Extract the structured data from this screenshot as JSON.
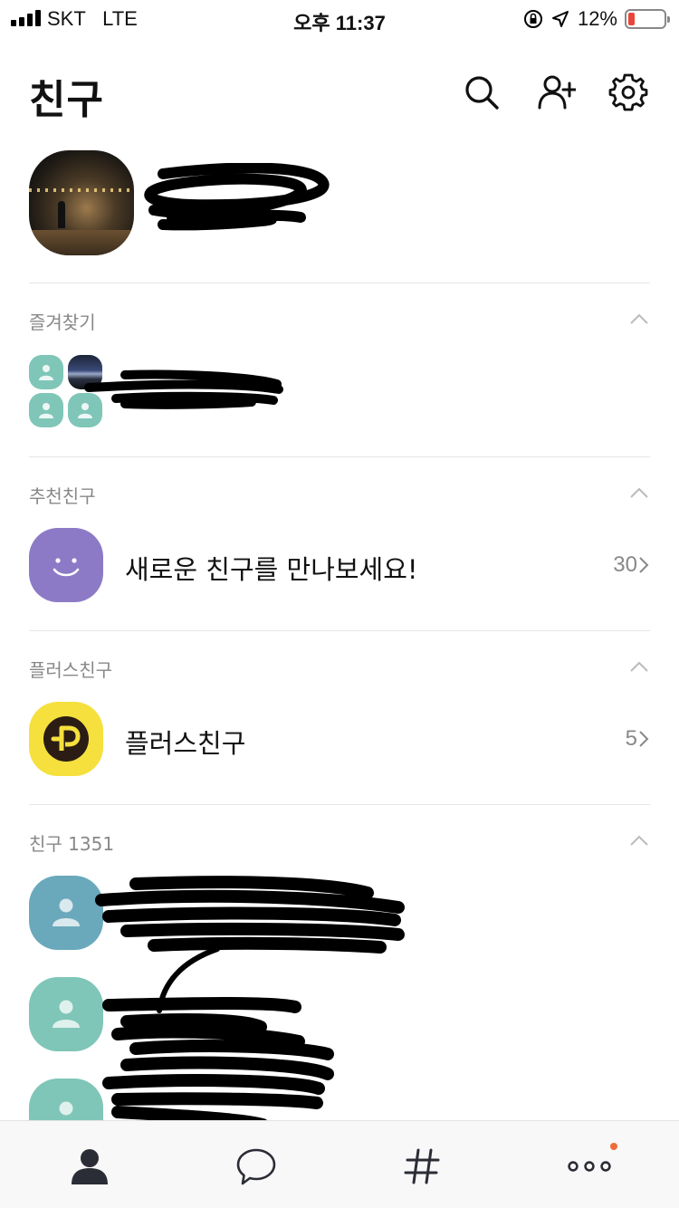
{
  "status_bar": {
    "carrier": "SKT",
    "network": "LTE",
    "time": "오후 11:37",
    "battery_percent": "12%",
    "battery_level": 0.12
  },
  "header": {
    "title": "친구",
    "icons": [
      "search-icon",
      "add-friend-icon",
      "settings-icon"
    ]
  },
  "sections": {
    "favorites": {
      "label": "즐겨찾기"
    },
    "recommended": {
      "label": "추천친구",
      "item_title": "새로운 친구를 만나보세요!",
      "item_count": "30"
    },
    "plus_friends": {
      "label": "플러스친구",
      "item_title": "플러스친구",
      "item_count": "5"
    },
    "friends": {
      "label": "친구 1351"
    }
  },
  "tabbar": {
    "tabs": [
      "friends-tab",
      "chats-tab",
      "hashtag-tab",
      "more-tab"
    ],
    "notification_dot_color": "#ef6c3a"
  },
  "colors": {
    "accent_purple": "#8c7ac6",
    "plus_yellow": "#f5e03d",
    "avatar_teal": "#7fc6b8",
    "avatar_blue": "#6aa9bb",
    "battery_red": "#e8463b"
  }
}
